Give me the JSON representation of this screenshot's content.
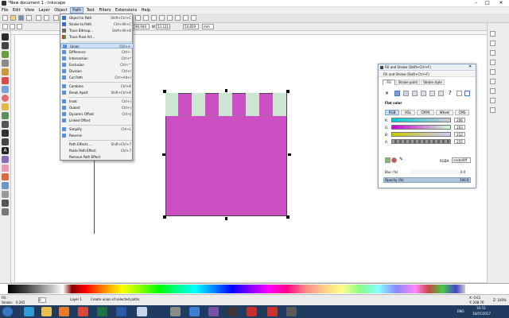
{
  "window": {
    "title": "*New document 1 - Inkscape",
    "minimize_icon": "minimize-icon",
    "maximize_icon": "maximize-icon",
    "close_icon": "close-icon"
  },
  "menubar": {
    "items": [
      "File",
      "Edit",
      "View",
      "Layer",
      "Object",
      "Path",
      "Text",
      "Filters",
      "Extensions",
      "Help"
    ],
    "active": "Path"
  },
  "toolctl": {
    "w": "90.940",
    "h_label": "W",
    "x_val": "53.121",
    "h_val": "54.859",
    "unit": "mm"
  },
  "path_menu": {
    "items": [
      {
        "label": "Object to Path",
        "shortcut": "Shift+Ctrl+C"
      },
      {
        "label": "Stroke to Path",
        "shortcut": "Ctrl+Alt+C"
      },
      {
        "label": "Trace Bitmap...",
        "shortcut": "Shift+Alt+B"
      },
      {
        "label": "Trace Pixel Art...",
        "shortcut": ""
      },
      {
        "label": "Union",
        "shortcut": "Ctrl++"
      },
      {
        "label": "Difference",
        "shortcut": "Ctrl+-"
      },
      {
        "label": "Intersection",
        "shortcut": "Ctrl+*"
      },
      {
        "label": "Exclusion",
        "shortcut": "Ctrl+^"
      },
      {
        "label": "Division",
        "shortcut": "Ctrl+/"
      },
      {
        "label": "Cut Path",
        "shortcut": "Ctrl+Alt+/"
      },
      {
        "label": "Combine",
        "shortcut": "Ctrl+K"
      },
      {
        "label": "Break Apart",
        "shortcut": "Shift+Ctrl+K"
      },
      {
        "label": "Inset",
        "shortcut": "Ctrl+("
      },
      {
        "label": "Outset",
        "shortcut": "Ctrl+)"
      },
      {
        "label": "Dynamic Offset",
        "shortcut": "Ctrl+J"
      },
      {
        "label": "Linked Offset",
        "shortcut": ""
      },
      {
        "label": "Simplify",
        "shortcut": "Ctrl+L"
      },
      {
        "label": "Reverse",
        "shortcut": ""
      },
      {
        "label": "Path Effects ...",
        "shortcut": "Shift+Ctrl+7"
      },
      {
        "label": "Paste Path Effect",
        "shortcut": "Ctrl+7"
      },
      {
        "label": "Remove Path Effect",
        "shortcut": ""
      }
    ],
    "highlighted": "Union"
  },
  "dialog": {
    "title": "Fill and Stroke (Shift+Ctrl+F)",
    "subtitle": "Fill and Stroke (Shift+Ctrl+F)",
    "tabs": [
      "Fill",
      "Stroke paint",
      "Stroke style"
    ],
    "mode_label": "Flat color",
    "color_tabs": [
      "RGB",
      "HSL",
      "CMYK",
      "Wheel",
      "CMS"
    ],
    "channels": [
      {
        "name": "R:",
        "value": "206"
      },
      {
        "name": "G:",
        "value": "203"
      },
      {
        "name": "B:",
        "value": "212"
      },
      {
        "name": "A:",
        "value": "255"
      }
    ],
    "rgba_label": "RGBA:",
    "rgba_value": "cecbd4ff",
    "blur_label": "Blur (%)",
    "blur_value": "0.0",
    "opacity_label": "Opacity (%)",
    "opacity_value": "100.0"
  },
  "status": {
    "fill_label": "Fill:",
    "stroke_label": "Stroke:",
    "stroke_value": "0.265",
    "opacity_value": "0",
    "layer": "Layer 1",
    "message": "Create union of selected paths",
    "x": "X: 0.61",
    "y": "Y: 208.76",
    "zoom": "Z: 100%",
    "coord_x": "0.61",
    "coord_y": "208.76"
  },
  "taskbar": {
    "time": "16:53",
    "date": "10/07/2017",
    "lang": "ENG"
  },
  "colors": {
    "shape_fill": "#cc4fc4",
    "stripe_fill": "#cde6d4",
    "accent": "#3875d7"
  }
}
